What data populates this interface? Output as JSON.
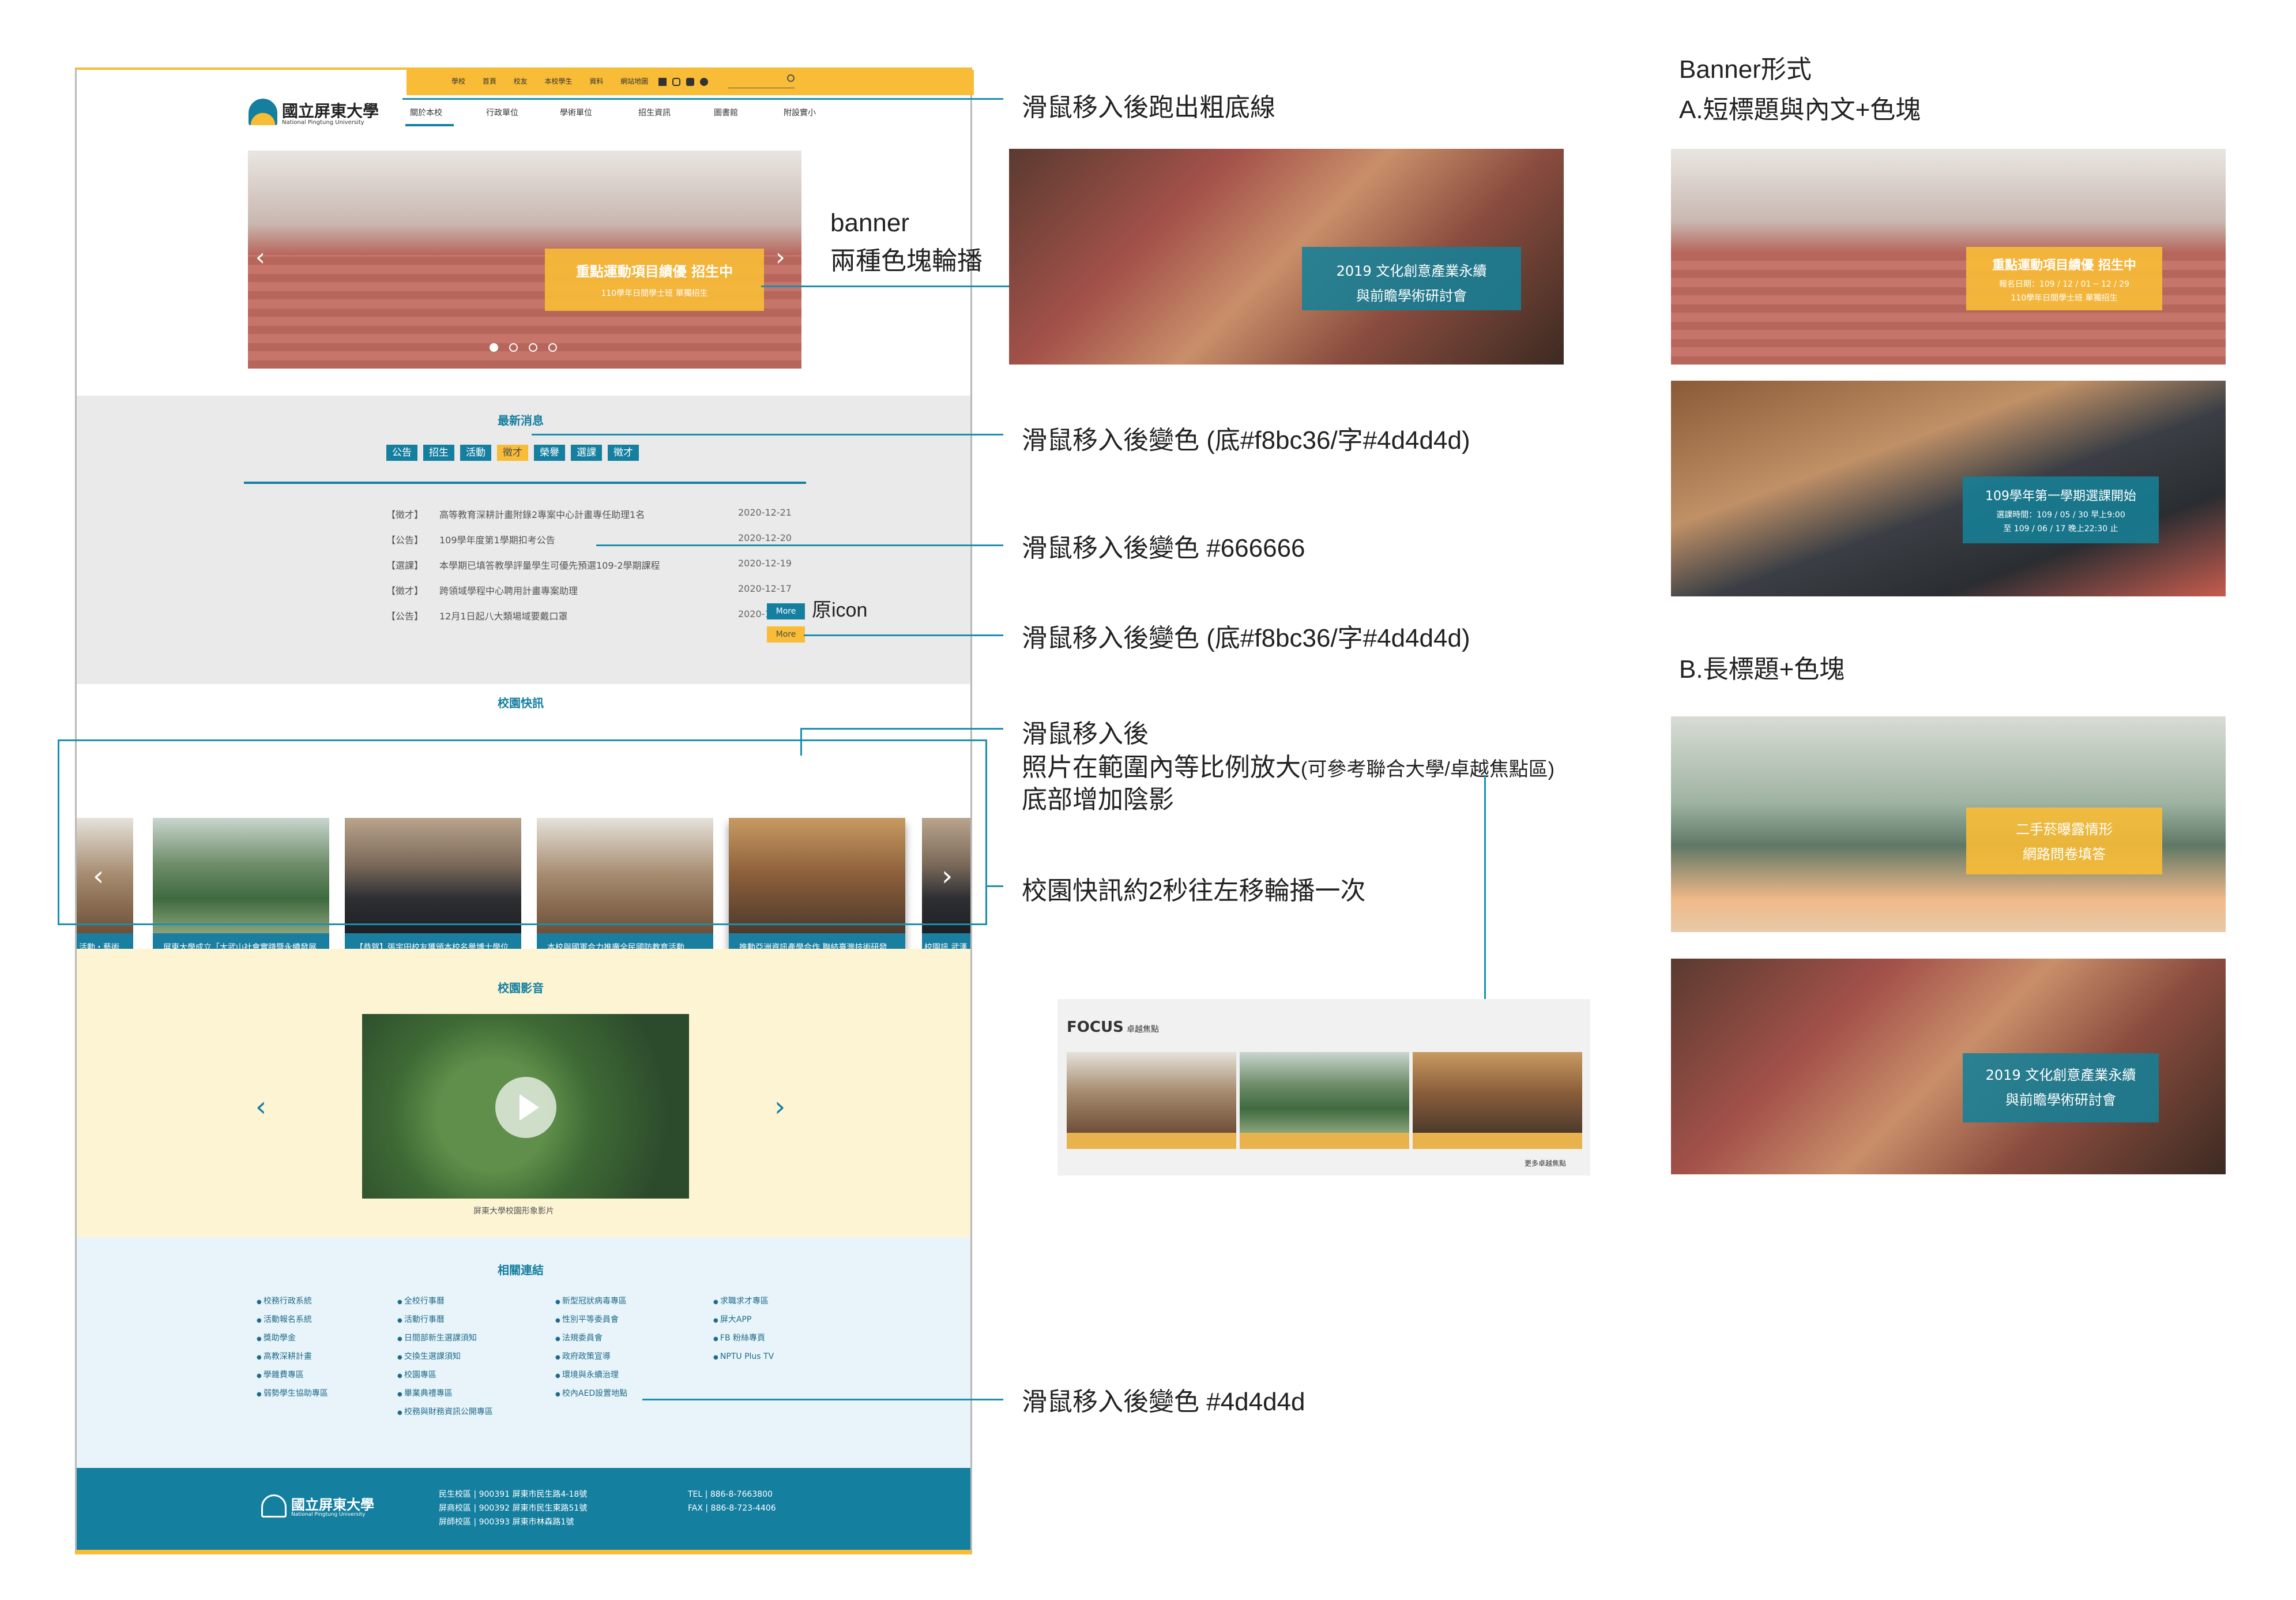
{
  "topbar": {
    "links": [
      "學校",
      "首頁",
      "校友",
      "本校學生",
      "資料",
      "網站地圖"
    ],
    "search_icon": "search-icon"
  },
  "logo": {
    "name": "國立屏東大學",
    "sub": "National Pingtung University"
  },
  "nav": [
    "關於本校",
    "行政單位",
    "學術單位",
    "招生資訊",
    "圖書館",
    "附設實小"
  ],
  "hero": {
    "title": "重點運動項目績優 招生中",
    "subtitle": "110學年日間學士班 單獨招生"
  },
  "hero_note": {
    "line1": "banner",
    "line2": "兩種色塊輪播"
  },
  "hero_alt": {
    "title": "2019 文化創意產業永續",
    "title2": "與前瞻學術研討會"
  },
  "news": {
    "heading": "最新消息",
    "tabs": [
      "公告",
      "招生",
      "活動",
      "徵才",
      "榮譽",
      "選課",
      "徵才"
    ],
    "items": [
      {
        "cat": "【徵才】",
        "title": "高等教育深耕計畫附錄2專案中心計畫專任助理1名",
        "date": "2020-12-21"
      },
      {
        "cat": "【公告】",
        "title": "109學年度第1學期扣考公告",
        "date": "2020-12-20"
      },
      {
        "cat": "【選課】",
        "title": "本學期已填答教學評量學生可優先預選109-2學期課程",
        "date": "2020-12-19"
      },
      {
        "cat": "【徵才】",
        "title": "跨領域學程中心聘用計畫專案助理",
        "date": "2020-12-17"
      },
      {
        "cat": "【公告】",
        "title": "12月1日起八大類場域要戴口罩",
        "date": "2020-12-16"
      }
    ],
    "more": "More",
    "more_note": "原icon"
  },
  "campus_news": {
    "heading": "校園快訊",
    "cards": [
      "屏東大學成立「大武山社會實踐暨永續發展中心」",
      "【恭賀】張宇田校友獲頒本校名譽博士學位",
      "本校與國軍合力推廣全民國防教育活動",
      "推動亞洲資訊產學合作 聯結臺灣技術研發能量"
    ],
    "edge_left": "活動・藝術",
    "edge_right": "校園訊 武漢肺"
  },
  "video": {
    "heading": "校園影音",
    "caption": "屏東大學校園形象影片"
  },
  "links": {
    "heading": "相關連結",
    "col1": [
      "校務行政系統",
      "活動報名系統",
      "獎助學金",
      "高教深耕計畫",
      "學雜費專區",
      "弱勢學生協助專區"
    ],
    "col2": [
      "全校行事曆",
      "活動行事曆",
      "日間部新生選課須知",
      "交換生選課須知",
      "校園專區",
      "畢業典禮專區",
      "校務與財務資訊公開專區"
    ],
    "col3": [
      "新型冠狀病毒專區",
      "性別平等委員會",
      "法規委員會",
      "政府政策宣導",
      "環境與永續治理",
      "校內AED設置地點"
    ],
    "col4": [
      "求職求才專區",
      "屏大APP",
      "FB 粉絲專頁",
      "NPTU Plus TV"
    ]
  },
  "footer": {
    "campus": [
      "民生校區 | 900391 屏東市民生路4-18號",
      "屏商校區 | 900392 屏東市民生東路51號",
      "屏師校區 | 900393 屏東市林森路1號"
    ],
    "contact": [
      "TEL | 886-8-7663800",
      "FAX | 886-8-723-4406"
    ]
  },
  "annotations": {
    "nav": "滑鼠移入後跑出粗底線",
    "tab": "滑鼠移入後變色 (底#f8bc36/字#4d4d4d)",
    "news_item": "滑鼠移入後變色 #666666",
    "more": "滑鼠移入後變色 (底#f8bc36/字#4d4d4d)",
    "photo1": "滑鼠移入後",
    "photo2": "照片在範圍內等比例放大",
    "photo2_small": "(可參考聯合大學/卓越焦點區)",
    "photo3": "底部增加陰影",
    "carousel": "校園快訊約2秒往左移輪播一次",
    "links": "滑鼠移入後變色 #4d4d4d"
  },
  "banner_forms": {
    "title": "Banner形式",
    "a": "A.短標題與內文+色塊",
    "b": "B.長標題+色塊",
    "a1_title": "重點運動項目績優 招生中",
    "a1_sub1": "報名日期：109 / 12 / 01 ─ 12 / 29",
    "a1_sub2": "110學年日間學士班 單獨招生",
    "a2_title": "109學年第一學期選課開始",
    "a2_sub1": "選課時間：109 / 05 / 30 早上9:00",
    "a2_sub2": "至 109 / 06 / 17 晚上22:30 止",
    "b1_title1": "二手菸曝露情形",
    "b1_title2": "網路問卷填答",
    "b2_title1": "2019 文化創意產業永續",
    "b2_title2": "與前瞻學術研討會"
  },
  "focus": {
    "title": "FOCUS",
    "sub": "卓越焦點",
    "more": "更多卓越焦點"
  },
  "colors": {
    "teal": "#157fa0",
    "yellow": "#f8bc36",
    "text_hover": "#4d4d4d",
    "gray_hover": "#666666"
  }
}
